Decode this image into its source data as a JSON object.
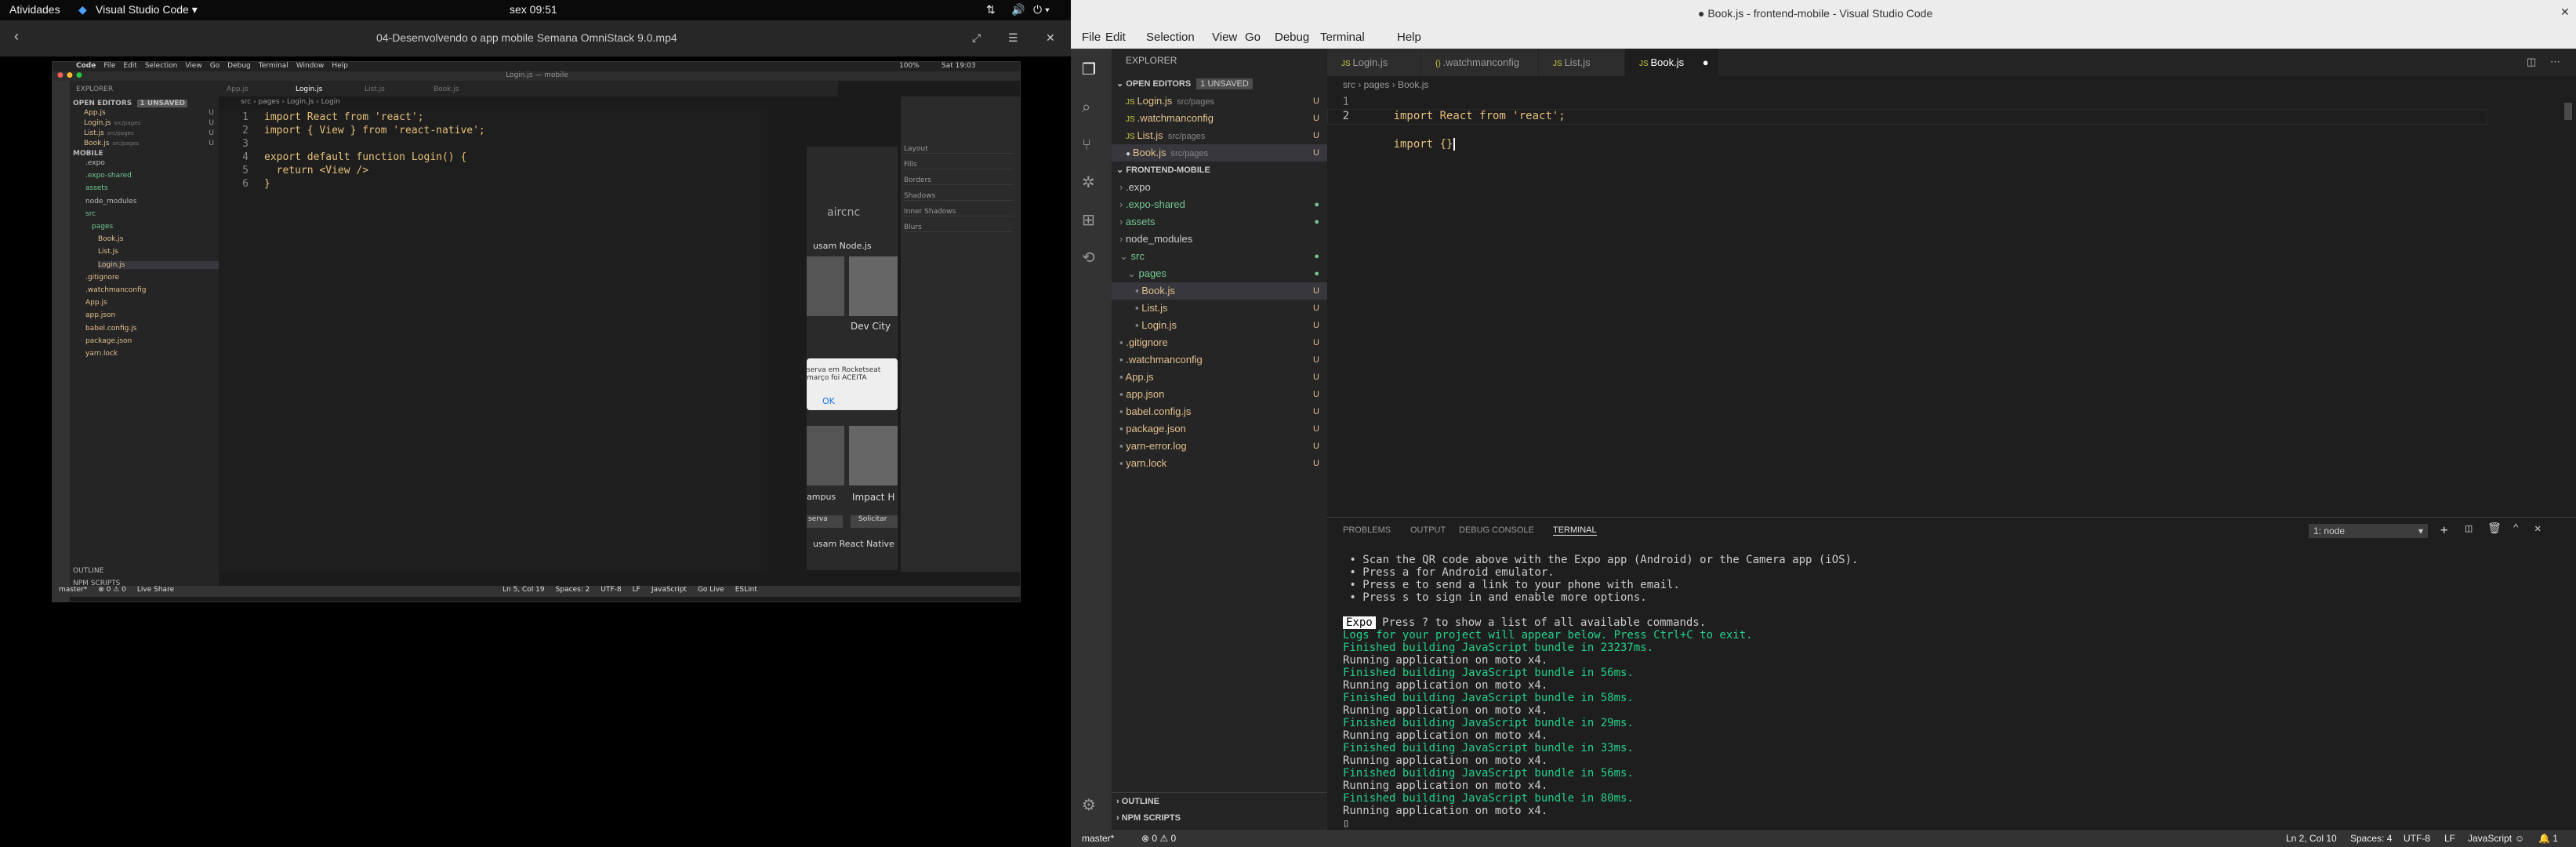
{
  "topbar": {
    "activities": "Atividades",
    "app": "Visual Studio Code",
    "clock": "sex 09:51"
  },
  "video": {
    "title": "04-Desenvolvendo o app mobile  Semana OmniStack 9.0.mp4",
    "mac_menu": [
      "Code",
      "File",
      "Edit",
      "Selection",
      "View",
      "Go",
      "Debug",
      "Terminal",
      "Window",
      "Help"
    ],
    "mac_title": "Login.js — mobile",
    "mac_clock": "Sat 19:03",
    "mac_battery": "100%",
    "sidebar_header": "EXPLORER",
    "open_editors": "OPEN EDITORS",
    "unsaved": "1 UNSAVED",
    "open_files": [
      {
        "name": "App.js",
        "hint": "",
        "mark": "U"
      },
      {
        "name": "Login.js",
        "hint": "src/pages",
        "mark": "U"
      },
      {
        "name": "List.js",
        "hint": "src/pages",
        "mark": "U"
      },
      {
        "name": "Book.js",
        "hint": "src/pages",
        "mark": "U"
      }
    ],
    "project": "MOBILE",
    "tree": [
      ".expo",
      ".expo-shared",
      "assets",
      "node_modules",
      "src",
      "pages",
      "Book.js",
      "List.js",
      "Login.js",
      ".gitignore",
      ".watchmanconfig",
      "App.js",
      "app.json",
      "babel.config.js",
      "package.json",
      "yarn.lock"
    ],
    "tabs": [
      "App.js",
      "Login.js",
      "List.js",
      "Book.js"
    ],
    "breadcrumb": "src › pages › Login.js › Login",
    "code": [
      "import React from 'react';",
      "import { View } from 'react-native';",
      "",
      "export default function Login() {",
      "  return <View />",
      "}"
    ],
    "line_numbers": [
      "1",
      "2",
      "3",
      "4",
      "5",
      "6"
    ],
    "outline": "OUTLINE",
    "npm": "NPM SCRIPTS",
    "status_left": [
      "master*",
      "⊗ 0 ⚠ 0",
      "Live Share"
    ],
    "status_right": [
      "Ln 5, Col 19",
      "Spaces: 2",
      "UTF-8",
      "LF",
      "JavaScript",
      "Go Live",
      "ESLint"
    ],
    "phone": {
      "brand": "aircnc",
      "card1": "usam Node.js",
      "card2": "Dev City",
      "alert": "serva em Rocketseat\nmarço foi ACEITA",
      "ok": "OK",
      "card3": "Impact H",
      "card4": "usam React Native",
      "tag1": "ampus",
      "btn1": "serva",
      "btn2": "Solicitar"
    },
    "inspector": [
      "Layout",
      "Fills",
      "Borders",
      "Shadows",
      "Inner Shadows",
      "Blurs"
    ]
  },
  "vscode": {
    "title": "● Book.js - frontend-mobile - Visual Studio Code",
    "menu": [
      "File",
      "Edit",
      "Selection",
      "View",
      "Go",
      "Debug",
      "Terminal",
      "Help"
    ],
    "explorer": "EXPLORER",
    "open_editors": "OPEN EDITORS",
    "unsaved": "1 UNSAVED",
    "open_files": [
      {
        "name": "Login.js",
        "hint": "src/pages",
        "mark": "U"
      },
      {
        "name": ".watchmanconfig",
        "hint": "",
        "mark": "U"
      },
      {
        "name": "List.js",
        "hint": "src/pages",
        "mark": "U"
      },
      {
        "name": "Book.js",
        "hint": "src/pages",
        "mark": "U"
      }
    ],
    "project": "FRONTEND-MOBILE",
    "tree": [
      {
        "name": ".expo",
        "mark": ""
      },
      {
        "name": ".expo-shared",
        "mark": "●"
      },
      {
        "name": "assets",
        "mark": "●"
      },
      {
        "name": "node_modules",
        "mark": ""
      },
      {
        "name": "src",
        "mark": "●"
      },
      {
        "name": "pages",
        "mark": "●"
      },
      {
        "name": "Book.js",
        "mark": "U"
      },
      {
        "name": "List.js",
        "mark": "U"
      },
      {
        "name": "Login.js",
        "mark": "U"
      },
      {
        "name": ".gitignore",
        "mark": "U"
      },
      {
        "name": ".watchmanconfig",
        "mark": "U"
      },
      {
        "name": "App.js",
        "mark": "U"
      },
      {
        "name": "app.json",
        "mark": "U"
      },
      {
        "name": "babel.config.js",
        "mark": "U"
      },
      {
        "name": "package.json",
        "mark": "U"
      },
      {
        "name": "yarn-error.log",
        "mark": "U"
      },
      {
        "name": "yarn.lock",
        "mark": "U"
      }
    ],
    "outline": "OUTLINE",
    "npm": "NPM SCRIPTS",
    "tabs": [
      "Login.js",
      ".watchmanconfig",
      "List.js",
      "Book.js"
    ],
    "breadcrumb": "src › pages › Book.js",
    "code_line1": "import React from 'react';",
    "code_line2": "import {}",
    "panel_tabs": [
      "PROBLEMS",
      "OUTPUT",
      "DEBUG CONSOLE",
      "TERMINAL"
    ],
    "terminal_select": "1: node",
    "terminal": [
      {
        "t": " • Scan the QR code above with the Expo app (Android) or the Camera app (iOS).",
        "c": ""
      },
      {
        "t": " • Press a for Android emulator.",
        "c": ""
      },
      {
        "t": " • Press e to send a link to your phone with email.",
        "c": ""
      },
      {
        "t": " • Press s to sign in and enable more options.",
        "c": ""
      },
      {
        "t": "",
        "c": ""
      },
      {
        "t": " Press ? to show a list of all available commands.",
        "c": "expo"
      },
      {
        "t": "Logs for your project will appear below. Press Ctrl+C to exit.",
        "c": "grn"
      },
      {
        "t": "Finished building JavaScript bundle in 23237ms.",
        "c": "grn"
      },
      {
        "t": "Running application on moto x4.",
        "c": ""
      },
      {
        "t": "Finished building JavaScript bundle in 56ms.",
        "c": "grn"
      },
      {
        "t": "Running application on moto x4.",
        "c": ""
      },
      {
        "t": "Finished building JavaScript bundle in 58ms.",
        "c": "grn"
      },
      {
        "t": "Running application on moto x4.",
        "c": ""
      },
      {
        "t": "Finished building JavaScript bundle in 29ms.",
        "c": "grn"
      },
      {
        "t": "Running application on moto x4.",
        "c": ""
      },
      {
        "t": "Finished building JavaScript bundle in 33ms.",
        "c": "grn"
      },
      {
        "t": "Running application on moto x4.",
        "c": ""
      },
      {
        "t": "Finished building JavaScript bundle in 56ms.",
        "c": "grn"
      },
      {
        "t": "Running application on moto x4.",
        "c": ""
      },
      {
        "t": "Finished building JavaScript bundle in 80ms.",
        "c": "grn"
      },
      {
        "t": "Running application on moto x4.",
        "c": ""
      },
      {
        "t": "▯",
        "c": ""
      }
    ],
    "expo_badge": "Expo",
    "status": {
      "branch": "master*",
      "problems": "⊗ 0 ⚠ 0",
      "position": "Ln 2, Col 10",
      "spaces": "Spaces: 4",
      "encoding": "UTF-8",
      "eol": "LF",
      "language": "JavaScript",
      "bell": "🔔 1"
    }
  }
}
